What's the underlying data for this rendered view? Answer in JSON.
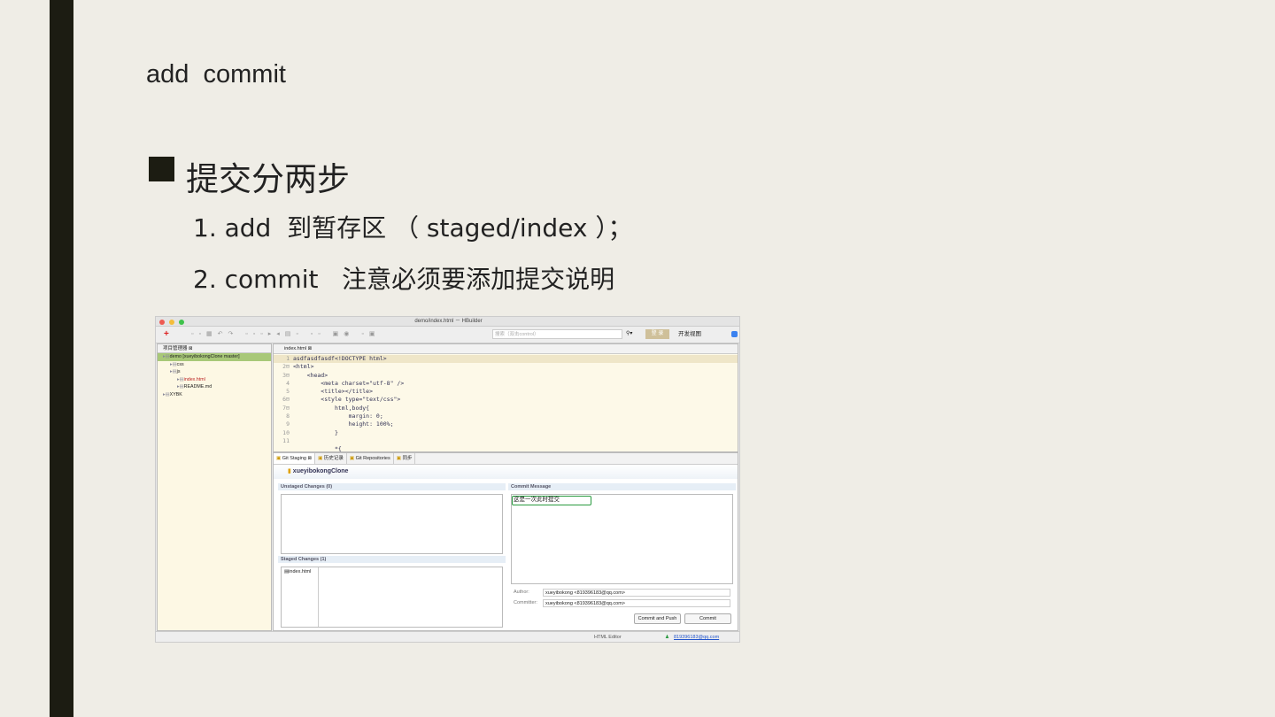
{
  "slide": {
    "title": "add  commit",
    "heading": "提交分两步",
    "items": [
      "1. add  到暂存区 （ staged/index ）；",
      "2. commit   注意必须要添加提交说明"
    ]
  },
  "app": {
    "window_title": "demo/index.html － HBuilder",
    "search_placeholder": "搜索（双击control）",
    "view_selector": "开发视图",
    "login_button": "登 录",
    "project_panel": {
      "tab": "项目管理器 ⊠",
      "tree": [
        {
          "label": "demo [xueyibokongClone master]",
          "indent": 0,
          "selected": true
        },
        {
          "label": "css",
          "indent": 1
        },
        {
          "label": "js",
          "indent": 1
        },
        {
          "label": "index.html",
          "indent": 2,
          "modified": true
        },
        {
          "label": "README.md",
          "indent": 2
        },
        {
          "label": "XYBK",
          "indent": 0
        }
      ]
    },
    "editor": {
      "tab": "index.html ⊠",
      "lines": [
        {
          "n": "1",
          "code": "asdfasdfasdf<!DOCTYPE html>"
        },
        {
          "n": "2⊟",
          "code": "<html>"
        },
        {
          "n": "3⊟",
          "code": "    <head>"
        },
        {
          "n": "4",
          "code": "        <meta charset=\"utf-8\" />"
        },
        {
          "n": "5",
          "code": "        <title></title>"
        },
        {
          "n": "6⊟",
          "code": "        <style type=\"text/css\">"
        },
        {
          "n": "7⊟",
          "code": "            html,body{"
        },
        {
          "n": "8",
          "code": "                margin: 0;"
        },
        {
          "n": "9",
          "code": "                height: 100%;"
        },
        {
          "n": "10",
          "code": "            }"
        },
        {
          "n": "11",
          "code": ""
        },
        {
          "n": "",
          "code": "            *{"
        }
      ]
    },
    "git": {
      "tabs": [
        "Git Staging ⊠",
        "历史记录",
        "Git Repositories",
        "同步"
      ],
      "repo": "xueyibokongClone",
      "unstaged_header": "Unstaged Changes (0)",
      "staged_header": "Staged Changes (1)",
      "staged_files": [
        "index.html"
      ],
      "commit_header": "Commit Message",
      "commit_message": "这是一次此时提交",
      "author_label": "Author:",
      "author": "xueyibokong <819396183@qq.com>",
      "committer_label": "Committer:",
      "committer": "xueyibokong <819396183@qq.com>",
      "commit_push": "Commit and Push",
      "commit": "Commit"
    },
    "status": {
      "editor": "HTML Editor",
      "user": "819396183@qq.com"
    }
  }
}
